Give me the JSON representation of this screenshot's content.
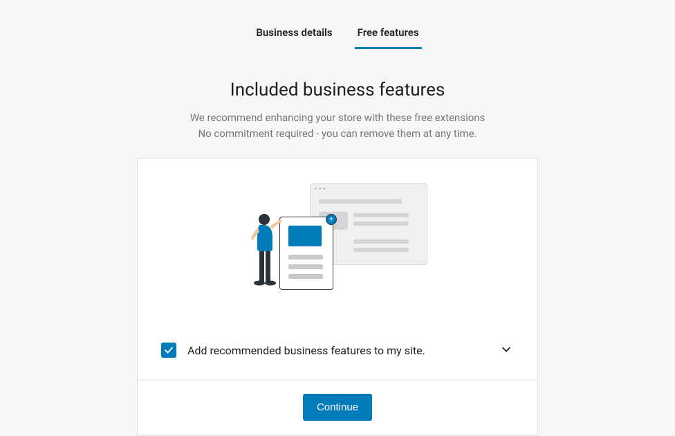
{
  "tabs": [
    {
      "label": "Business details",
      "active": false
    },
    {
      "label": "Free features",
      "active": true
    }
  ],
  "header": {
    "title": "Included business features",
    "subtitle_line1": "We recommend enhancing your store with these free extensions",
    "subtitle_line2": "No commitment required - you can remove them at any time."
  },
  "checkbox": {
    "checked": true,
    "label": "Add recommended business features to my site."
  },
  "actions": {
    "continue_label": "Continue"
  }
}
